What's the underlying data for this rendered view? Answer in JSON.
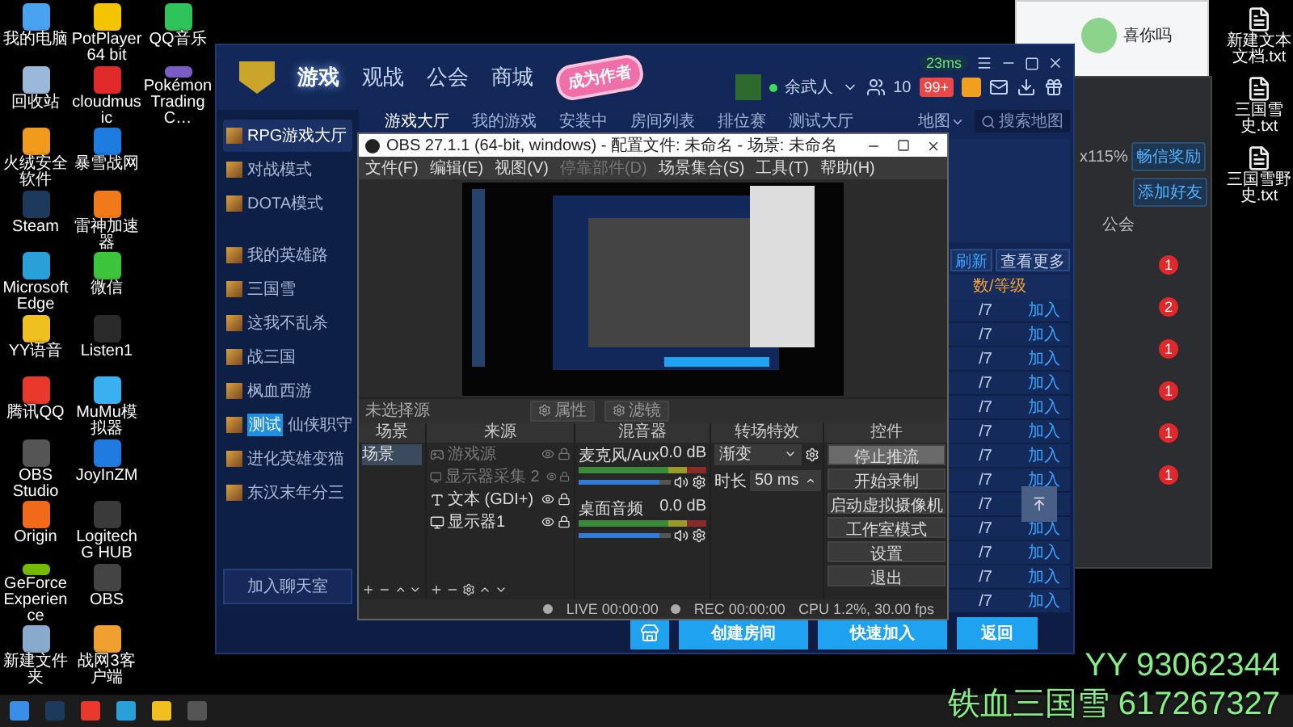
{
  "desktop_icons": [
    [
      {
        "label": "我的电脑",
        "color": "#4aa3f0"
      },
      {
        "label": "PotPlayer 64 bit",
        "color": "#f5c400"
      },
      {
        "label": "QQ音乐",
        "color": "#2fc45a"
      }
    ],
    [
      {
        "label": "回收站",
        "color": "#9ab8d8"
      },
      {
        "label": "cloudmusic",
        "color": "#e02a2a"
      },
      {
        "label": "Pokémon Trading C…",
        "color": "#7b5cc4"
      }
    ],
    [
      {
        "label": "火绒安全软件",
        "color": "#f29a1c"
      },
      {
        "label": "暴雪战网",
        "color": "#1e7be0"
      }
    ],
    [
      {
        "label": "Steam",
        "color": "#1b3a5c"
      },
      {
        "label": "雷神加速器",
        "color": "#f07a1a"
      }
    ],
    [
      {
        "label": "Microsoft Edge",
        "color": "#2aa0d8"
      },
      {
        "label": "微信",
        "color": "#3cc43c"
      }
    ],
    [
      {
        "label": "YY语音",
        "color": "#f0c020"
      },
      {
        "label": "Listen1",
        "color": "#2a2a2a"
      }
    ],
    [
      {
        "label": "腾讯QQ",
        "color": "#e8392c"
      },
      {
        "label": "MuMu模拟器",
        "color": "#3ab0f0"
      }
    ],
    [
      {
        "label": "OBS Studio",
        "color": "#555555"
      },
      {
        "label": "JoyInZM",
        "color": "#1f7be0"
      }
    ],
    [
      {
        "label": "Origin",
        "color": "#f06a1a"
      },
      {
        "label": "Logitech G HUB",
        "color": "#3a3a3a"
      }
    ],
    [
      {
        "label": "GeForce Experience",
        "color": "#76b900"
      },
      {
        "label": "OBS",
        "color": "#444444"
      }
    ],
    [
      {
        "label": "新建文件夹",
        "color": "#88aacc"
      },
      {
        "label": "战网3客户端",
        "color": "#f0a030"
      }
    ]
  ],
  "desktop_files": [
    {
      "label": "新建文本文档.txt"
    },
    {
      "label": "三国雪史.txt"
    },
    {
      "label": "三国雪野史.txt"
    }
  ],
  "qq_window": {
    "name": "喜你吗"
  },
  "chat_window": {
    "zoom": "x115%",
    "buttons": [
      "畅信奖励",
      "添加好友"
    ],
    "tab": "公会",
    "badges": [
      "1",
      "2",
      "1",
      "1",
      "1",
      "1"
    ]
  },
  "game_client": {
    "ping": "23ms",
    "nav": [
      {
        "label": "游戏",
        "selected": true
      },
      {
        "label": "观战",
        "selected": false
      },
      {
        "label": "公会",
        "selected": false
      },
      {
        "label": "商城",
        "selected": false
      }
    ],
    "author_badge": "成为作者",
    "user": "余武人",
    "friend_count": "10",
    "message_badge": "99+",
    "sidebar": [
      {
        "label": "RPG游戏大厅",
        "selected": true
      },
      {
        "label": "对战模式",
        "selected": false
      },
      {
        "label": "DOTA模式",
        "selected": false
      },
      {
        "label": "我的英雄路",
        "selected": false
      },
      {
        "label": "三国雪",
        "selected": false
      },
      {
        "label": "这我不乱杀",
        "selected": false
      },
      {
        "label": "战三国",
        "selected": false
      },
      {
        "label": "枫血西游",
        "selected": false
      },
      {
        "label": "仙侠职守",
        "selected": false,
        "tag": "测试"
      },
      {
        "label": "进化英雄变猫",
        "selected": false
      },
      {
        "label": "东汉末年分三",
        "selected": false
      }
    ],
    "chat_room_button": "加入聊天室",
    "tabs": [
      {
        "label": "游戏大厅",
        "selected": true
      },
      {
        "label": "我的游戏",
        "selected": false
      },
      {
        "label": "安装中",
        "selected": false
      },
      {
        "label": "房间列表",
        "selected": false
      },
      {
        "label": "排位赛",
        "selected": false
      },
      {
        "label": "测试大厅",
        "selected": false
      }
    ],
    "map_filter": "地图",
    "search": {
      "placeholder": "搜索地图"
    },
    "refresh": "刷新",
    "more": "查看更多",
    "column_header": "数/等级",
    "rows": [
      {
        "players": "/7",
        "action": "加入"
      },
      {
        "players": "/7",
        "action": "加入"
      },
      {
        "players": "/7",
        "action": "加入"
      },
      {
        "players": "/7",
        "action": "加入"
      },
      {
        "players": "/7",
        "action": "加入"
      },
      {
        "players": "/7",
        "action": "加入"
      },
      {
        "players": "/7",
        "action": "加入"
      },
      {
        "players": "/7",
        "action": "加入"
      },
      {
        "players": "/7"
      },
      {
        "players": "/7",
        "action": "加入"
      },
      {
        "players": "/7",
        "action": "加入"
      },
      {
        "players": "/7",
        "action": "加入"
      },
      {
        "players": "/7",
        "action": "加入"
      }
    ],
    "buttons": [
      "创建房间",
      "快速加入",
      "返回"
    ]
  },
  "obs": {
    "title": "OBS 27.1.1 (64-bit, windows) - 配置文件: 未命名 - 场景: 未命名",
    "menu": [
      "文件(F)",
      "编辑(E)",
      "视图(V)",
      "停靠部件(D)",
      "场景集合(S)",
      "工具(T)",
      "帮助(H)"
    ],
    "source_status": "未选择源",
    "properties": "属性",
    "filters": "滤镜",
    "docks": [
      "场景",
      "来源",
      "混音器",
      "转场特效",
      "控件"
    ],
    "scenes": [
      {
        "label": "场景",
        "selected": true
      }
    ],
    "sources": [
      {
        "kind": "game",
        "label": "游戏源",
        "disabled": true
      },
      {
        "kind": "monitor",
        "label": "显示器采集 2",
        "disabled": true
      },
      {
        "kind": "text",
        "label": "文本 (GDI+)",
        "disabled": false
      },
      {
        "kind": "monitor",
        "label": "显示器1",
        "disabled": false
      }
    ],
    "mixer": [
      {
        "name": "麦克风/Aux",
        "reading": "0.0 dB",
        "level": 0.88
      },
      {
        "name": "桌面音频",
        "reading": "0.0 dB",
        "level": 0.88
      }
    ],
    "transition": {
      "type": "渐变",
      "duration_label": "时长",
      "duration": "50 ms"
    },
    "controls": [
      {
        "label": "停止推流",
        "active": true
      },
      {
        "label": "开始录制",
        "active": false
      },
      {
        "label": "启动虚拟摄像机",
        "active": false
      },
      {
        "label": "工作室模式",
        "active": false
      },
      {
        "label": "设置",
        "active": false
      },
      {
        "label": "退出",
        "active": false
      }
    ],
    "status": {
      "live": "LIVE 00:00:00",
      "rec": "REC 00:00:00",
      "cpu": "CPU 1.2%, 30.00 fps"
    }
  },
  "overlay": [
    "YY 93062344",
    "铁血三国雪 617267327"
  ]
}
